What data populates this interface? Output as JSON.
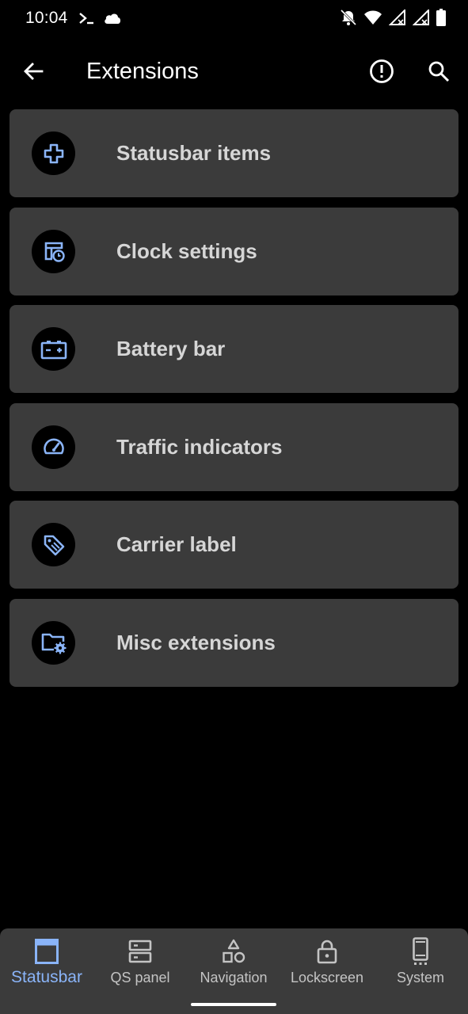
{
  "status_bar": {
    "time": "10:04",
    "left_icons": [
      "terminal-icon",
      "cloud-icon"
    ],
    "right_icons": [
      "notifications-off-icon",
      "wifi-icon",
      "signal-icon",
      "signal-icon",
      "battery-icon"
    ]
  },
  "app_bar": {
    "title": "Extensions",
    "back_icon": "arrow-back-icon",
    "actions": [
      "info-icon",
      "search-icon"
    ]
  },
  "items": [
    {
      "label": "Statusbar items",
      "icon": "add-box-icon"
    },
    {
      "label": "Clock settings",
      "icon": "schedule-calendar-icon"
    },
    {
      "label": "Battery bar",
      "icon": "battery-charging-icon"
    },
    {
      "label": "Traffic indicators",
      "icon": "speed-gauge-icon"
    },
    {
      "label": "Carrier label",
      "icon": "tag-icon"
    },
    {
      "label": "Misc extensions",
      "icon": "folder-settings-icon"
    }
  ],
  "bottom_nav": {
    "active_index": 0,
    "items": [
      {
        "label": "Statusbar",
        "icon": "statusbar-icon"
      },
      {
        "label": "QS panel",
        "icon": "qs-panel-icon"
      },
      {
        "label": "Navigation",
        "icon": "navigation-shapes-icon"
      },
      {
        "label": "Lockscreen",
        "icon": "lock-icon"
      },
      {
        "label": "System",
        "icon": "phone-icon"
      }
    ]
  },
  "colors": {
    "background": "#000000",
    "card": "#3b3b3b",
    "accent": "#8ab4f8",
    "card_text": "#d6d6d6",
    "nav_text": "#c4c4c4"
  }
}
